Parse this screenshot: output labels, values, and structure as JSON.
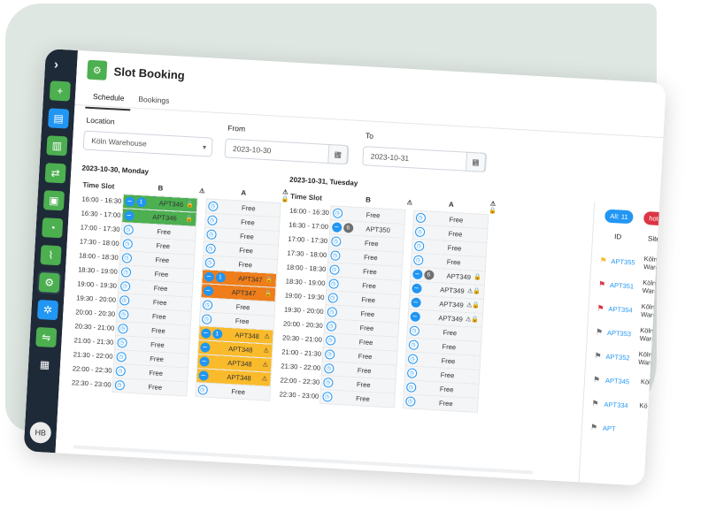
{
  "app": {
    "title": "Slot Booking"
  },
  "tabs": [
    {
      "label": "Schedule",
      "active": true
    },
    {
      "label": "Bookings",
      "active": false
    }
  ],
  "filters": {
    "location_label": "Location",
    "location_value": "Köln Warehouse",
    "from_label": "From",
    "from_value": "2023-10-30",
    "to_label": "To",
    "to_value": "2023-10-31"
  },
  "sidebar": {
    "items": [
      {
        "icon": "plus-icon",
        "color": "#4caf50"
      },
      {
        "icon": "warehouse-icon",
        "color": "#2196f3"
      },
      {
        "icon": "slot-config-icon",
        "color": "#4caf50"
      },
      {
        "icon": "delivery-icon",
        "color": "#4caf50"
      },
      {
        "icon": "truck-icon",
        "color": "#4caf50"
      },
      {
        "icon": "schedule-icon",
        "color": "#4caf50"
      },
      {
        "icon": "attachment-icon",
        "color": "#4caf50"
      },
      {
        "icon": "slot-booking-icon",
        "color": "#4caf50",
        "active": true
      },
      {
        "icon": "settings-icon",
        "color": "#2196f3"
      },
      {
        "icon": "sliders-icon",
        "color": "#4caf50"
      },
      {
        "icon": "apps-grid-icon",
        "color": "#1f2a38"
      }
    ],
    "avatar": "HB"
  },
  "schedule": {
    "time_slot_header": "Time Slot",
    "days": [
      {
        "title": "2023-10-30, Monday",
        "gates": [
          "B",
          "A"
        ],
        "rows": [
          {
            "time": "16:00 - 16:30",
            "cells": [
              {
                "text": "APT346",
                "state": "booked",
                "count": "1",
                "color": "green",
                "lock": true
              },
              {
                "text": "Free",
                "state": "free"
              }
            ]
          },
          {
            "time": "16:30 - 17:00",
            "cells": [
              {
                "text": "APT346",
                "state": "booked",
                "color": "green",
                "lock": true
              },
              {
                "text": "Free",
                "state": "free"
              }
            ]
          },
          {
            "time": "17:00 - 17:30",
            "cells": [
              {
                "text": "Free",
                "state": "free"
              },
              {
                "text": "Free",
                "state": "free"
              }
            ]
          },
          {
            "time": "17:30 - 18:00",
            "cells": [
              {
                "text": "Free",
                "state": "free"
              },
              {
                "text": "Free",
                "state": "free"
              }
            ]
          },
          {
            "time": "18:00 - 18:30",
            "cells": [
              {
                "text": "Free",
                "state": "free"
              },
              {
                "text": "Free",
                "state": "free"
              }
            ]
          },
          {
            "time": "18:30 - 19:00",
            "cells": [
              {
                "text": "Free",
                "state": "free"
              },
              {
                "text": "APT347",
                "state": "booked",
                "count": "1",
                "color": "orange",
                "lock": true
              }
            ]
          },
          {
            "time": "19:00 - 19:30",
            "cells": [
              {
                "text": "Free",
                "state": "free"
              },
              {
                "text": "APT347",
                "state": "booked",
                "color": "orange",
                "lock": true
              }
            ]
          },
          {
            "time": "19:30 - 20:00",
            "cells": [
              {
                "text": "Free",
                "state": "free"
              },
              {
                "text": "Free",
                "state": "free"
              }
            ]
          },
          {
            "time": "20:00 - 20:30",
            "cells": [
              {
                "text": "Free",
                "state": "free"
              },
              {
                "text": "Free",
                "state": "free"
              }
            ]
          },
          {
            "time": "20:30 - 21:00",
            "cells": [
              {
                "text": "Free",
                "state": "free"
              },
              {
                "text": "APT348",
                "state": "booked",
                "count": "1",
                "color": "yellow",
                "warn": true
              }
            ]
          },
          {
            "time": "21:00 - 21:30",
            "cells": [
              {
                "text": "Free",
                "state": "free"
              },
              {
                "text": "APT348",
                "state": "booked",
                "color": "yellow",
                "warn": true
              }
            ]
          },
          {
            "time": "21:30 - 22:00",
            "cells": [
              {
                "text": "Free",
                "state": "free"
              },
              {
                "text": "APT348",
                "state": "booked",
                "color": "yellow",
                "warn": true
              }
            ]
          },
          {
            "time": "22:00 - 22:30",
            "cells": [
              {
                "text": "Free",
                "state": "free"
              },
              {
                "text": "APT348",
                "state": "booked",
                "color": "yellow",
                "warn": true
              }
            ]
          },
          {
            "time": "22:30 - 23:00",
            "cells": [
              {
                "text": "Free",
                "state": "free"
              },
              {
                "text": "Free",
                "state": "free"
              }
            ]
          }
        ]
      },
      {
        "title": "2023-10-31, Tuesday",
        "gates": [
          "B",
          "A"
        ],
        "rows": [
          {
            "time": "16:00 - 16:30",
            "cells": [
              {
                "text": "Free",
                "state": "free"
              },
              {
                "text": "Free",
                "state": "free"
              }
            ]
          },
          {
            "time": "16:30 - 17:00",
            "cells": [
              {
                "text": "APT350",
                "state": "pending",
                "count": "6"
              },
              {
                "text": "Free",
                "state": "free"
              }
            ]
          },
          {
            "time": "17:00 - 17:30",
            "cells": [
              {
                "text": "Free",
                "state": "free"
              },
              {
                "text": "Free",
                "state": "free"
              }
            ]
          },
          {
            "time": "17:30 - 18:00",
            "cells": [
              {
                "text": "Free",
                "state": "free"
              },
              {
                "text": "Free",
                "state": "free"
              }
            ]
          },
          {
            "time": "18:00 - 18:30",
            "cells": [
              {
                "text": "Free",
                "state": "free"
              },
              {
                "text": "APT349",
                "state": "pending",
                "count": "6",
                "lock": true
              }
            ]
          },
          {
            "time": "18:30 - 19:00",
            "cells": [
              {
                "text": "Free",
                "state": "free"
              },
              {
                "text": "APT349",
                "state": "pending",
                "lock": true,
                "warn": true
              }
            ]
          },
          {
            "time": "19:00 - 19:30",
            "cells": [
              {
                "text": "Free",
                "state": "free"
              },
              {
                "text": "APT349",
                "state": "pending",
                "lock": true,
                "warn": true
              }
            ]
          },
          {
            "time": "19:30 - 20:00",
            "cells": [
              {
                "text": "Free",
                "state": "free"
              },
              {
                "text": "APT349",
                "state": "pending",
                "lock": true,
                "warn": true
              }
            ]
          },
          {
            "time": "20:00 - 20:30",
            "cells": [
              {
                "text": "Free",
                "state": "free"
              },
              {
                "text": "Free",
                "state": "free"
              }
            ]
          },
          {
            "time": "20:30 - 21:00",
            "cells": [
              {
                "text": "Free",
                "state": "free"
              },
              {
                "text": "Free",
                "state": "free"
              }
            ]
          },
          {
            "time": "21:00 - 21:30",
            "cells": [
              {
                "text": "Free",
                "state": "free"
              },
              {
                "text": "Free",
                "state": "free"
              }
            ]
          },
          {
            "time": "21:30 - 22:00",
            "cells": [
              {
                "text": "Free",
                "state": "free"
              },
              {
                "text": "Free",
                "state": "free"
              }
            ]
          },
          {
            "time": "22:00 - 22:30",
            "cells": [
              {
                "text": "Free",
                "state": "free"
              },
              {
                "text": "Free",
                "state": "free"
              }
            ]
          },
          {
            "time": "22:30 - 23:00",
            "cells": [
              {
                "text": "Free",
                "state": "free"
              },
              {
                "text": "Free",
                "state": "free"
              }
            ]
          }
        ]
      }
    ]
  },
  "right_panel": {
    "pills": [
      {
        "label": "All: 11",
        "color": "#2196f3"
      },
      {
        "label": "hot: 2",
        "color": "#dc3545"
      },
      {
        "label": "",
        "color": "#f9bb2c"
      }
    ],
    "col_id": "ID",
    "col_site": "Site",
    "rows": [
      {
        "flag_color": "#f9bb2c",
        "id": "APT355",
        "site": "Köln Warehouse"
      },
      {
        "flag_color": "#dc3545",
        "id": "APT351",
        "site": "Köln Warehouse"
      },
      {
        "flag_color": "#dc3545",
        "id": "APT354",
        "site": "Köln Warehouse"
      },
      {
        "flag_color": "#707070",
        "id": "APT353",
        "site": "Köln Warehouse"
      },
      {
        "flag_color": "#707070",
        "id": "APT352",
        "site": "Köln Warehouse"
      },
      {
        "flag_color": "#707070",
        "id": "APT345",
        "site": "Köln Wareho"
      },
      {
        "flag_color": "#707070",
        "id": "APT334",
        "site": "Kö"
      },
      {
        "flag_color": "#707070",
        "id": "APT",
        "site": ""
      }
    ]
  }
}
